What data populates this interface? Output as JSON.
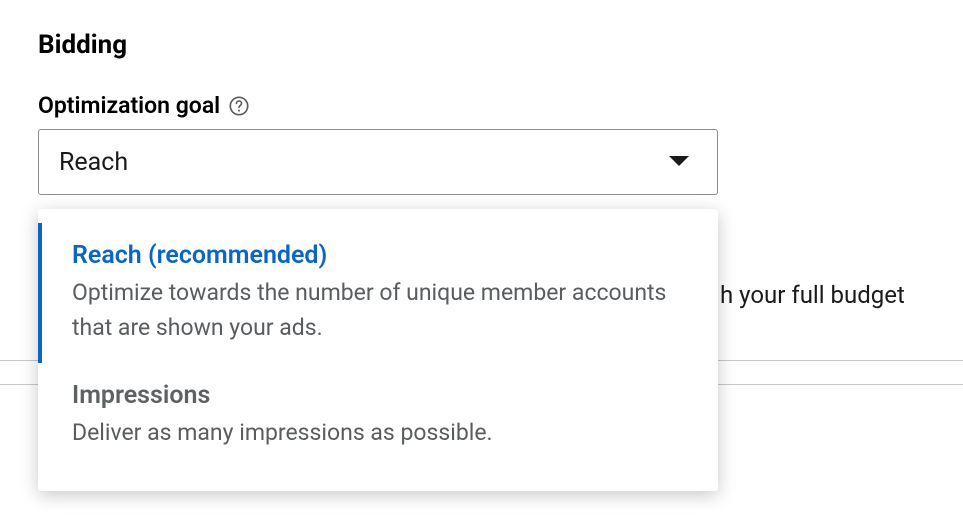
{
  "section": {
    "title": "Bidding"
  },
  "field": {
    "label": "Optimization goal"
  },
  "select": {
    "value": "Reach"
  },
  "options": [
    {
      "title": "Reach (recommended)",
      "desc": "Optimize towards the number of unique member accounts that are shown your ads."
    },
    {
      "title": "Impressions",
      "desc": "Deliver as many impressions as possible."
    }
  ],
  "bg_text": "h your full budget",
  "icons": {
    "help": "help-icon",
    "caret": "chevron-down-icon"
  }
}
